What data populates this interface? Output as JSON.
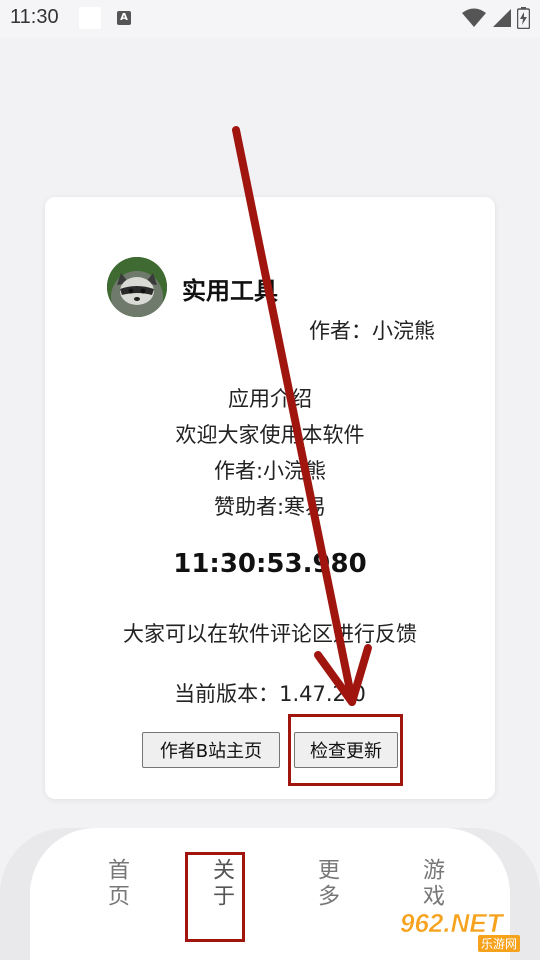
{
  "status_bar": {
    "time": "11:30"
  },
  "card": {
    "app_name": "实用工具",
    "author_line": "作者：小浣熊",
    "intro_title": "应用介绍",
    "intro_welcome": "欢迎大家使用本软件",
    "intro_author": "作者:小浣熊",
    "intro_sponsor": "赞助者:寒易",
    "clock": "11:30:53.980",
    "feedback": "大家可以在软件评论区进行反馈",
    "version": "当前版本：1.47.2.0",
    "btn_home": "作者B站主页",
    "btn_update": "检查更新"
  },
  "nav": {
    "home": "首页",
    "about": "关于",
    "more": "更多",
    "game": "游戏"
  },
  "watermark": {
    "brand": "962.NET",
    "sub": "乐游网"
  },
  "colors": {
    "annotation_red": "#a0160f",
    "watermark_orange": "#f6a21d"
  },
  "icons": [
    "wifi-icon",
    "signal-icon",
    "battery-icon",
    "notification-icon",
    "raccoon-avatar"
  ]
}
